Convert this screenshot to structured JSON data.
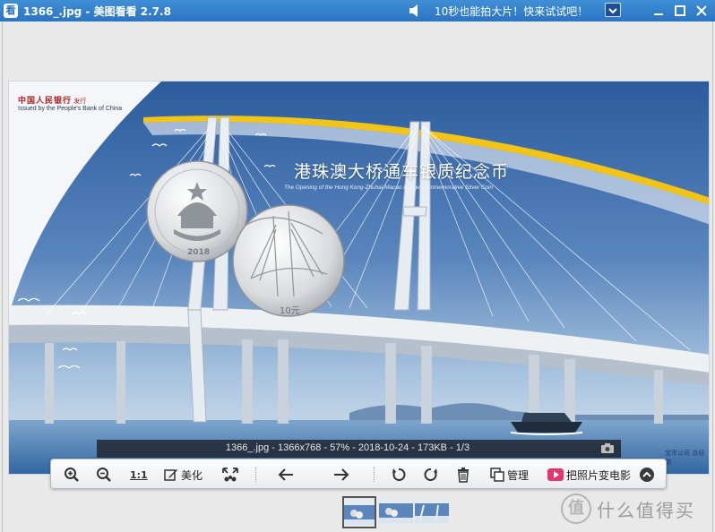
{
  "window": {
    "app_icon": "看",
    "title": "1366_.jpg - 美图看看 2.7.8",
    "promo": "10秒也能拍大片！快来试试吧！"
  },
  "photo": {
    "bank_cn": "中国人民银行",
    "bank_tag": "发行",
    "bank_en": "Issued by the People's Bank of China",
    "title": "港珠澳大桥通车银质纪念币",
    "subtitle": "The Opening of the Hong Kong-Zhuhai-Macao Bridge Commemorative Silver Coin",
    "coin_year": "2018",
    "coin_value": "10元",
    "maker": "宝币公司 总经销"
  },
  "info": {
    "filename": "1366_.jpg",
    "dimensions": "1366x768",
    "zoom": "57%",
    "date": "2018-10-24",
    "size": "173KB",
    "position": "1/3",
    "sep": " - "
  },
  "toolbar": {
    "one_to_one": "1:1",
    "beautify": "美化",
    "manage": "管理",
    "to_video": "把照片变电影"
  },
  "watermark": {
    "logo": "值",
    "text": "什么值得买"
  },
  "colors": {
    "titlebar": "#2b74c2",
    "sky": "#2d5fa3",
    "accent_yellow": "#f2c418"
  }
}
